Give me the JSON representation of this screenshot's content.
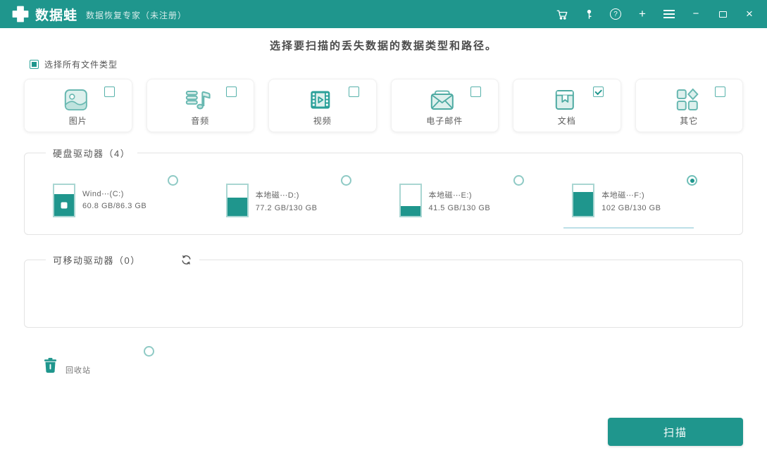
{
  "colors": {
    "primary": "#1f968d",
    "icon_stroke": "#68b8b1",
    "icon_fill": "#ddf0ed",
    "selected_underline": "#bcdfe7"
  },
  "titlebar": {
    "app_name": "数据蛙",
    "subtitle": "数据恢复专家（未注册）",
    "glyphs": {
      "help": "?",
      "plus": "+",
      "minimize": "−",
      "close": "×"
    }
  },
  "main": {
    "heading": "选择要扫描的丢失数据的数据类型和路径。",
    "select_all_label": "选择所有文件类型",
    "select_all_partial": true
  },
  "file_types": [
    {
      "label": "图片",
      "icon": "image-icon",
      "checked": false
    },
    {
      "label": "音频",
      "icon": "audio-icon",
      "checked": false
    },
    {
      "label": "视频",
      "icon": "video-icon",
      "checked": false
    },
    {
      "label": "电子邮件",
      "icon": "email-icon",
      "checked": false
    },
    {
      "label": "文档",
      "icon": "document-icon",
      "checked": true
    },
    {
      "label": "其它",
      "icon": "other-icon",
      "checked": false
    }
  ],
  "hard_drives": {
    "legend": "硬盘驱动器（4）",
    "drives": [
      {
        "name": "Wind⋯(C:)",
        "capacity": "60.8 GB/86.3 GB",
        "fill_percent": 70,
        "selected": false,
        "windows_logo": true
      },
      {
        "name": "本地磁⋯D:)",
        "capacity": "77.2 GB/130 GB",
        "fill_percent": 59,
        "selected": false,
        "windows_logo": false
      },
      {
        "name": "本地磁⋯E:)",
        "capacity": "41.5 GB/130 GB",
        "fill_percent": 32,
        "selected": false,
        "windows_logo": false
      },
      {
        "name": "本地磁⋯F:)",
        "capacity": "102 GB/130 GB",
        "fill_percent": 78,
        "selected": true,
        "windows_logo": false
      }
    ]
  },
  "removable_drives": {
    "legend": "可移动驱动器（0）",
    "count": 0
  },
  "recycle_bin": {
    "label": "回收站",
    "selected": false
  },
  "footer": {
    "scan_label": "扫描"
  }
}
